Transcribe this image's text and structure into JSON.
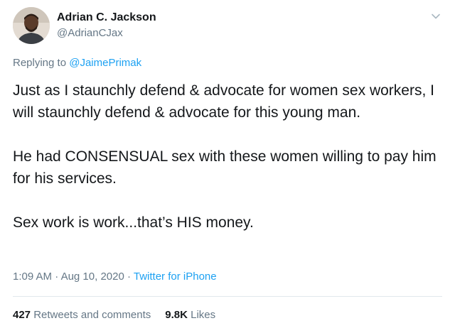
{
  "author": {
    "name": "Adrian C. Jackson",
    "handle": "@AdrianCJax"
  },
  "reply": {
    "prefix": "Replying to ",
    "to_handle": "@JaimePrimak"
  },
  "tweet": {
    "paragraphs": [
      "Just as I staunchly defend & advocate for women sex workers, I will staunchly defend & advocate for this young man.",
      "He had CONSENSUAL sex with these women willing to pay him for his services.",
      "Sex work is work...that’s HIS money."
    ]
  },
  "meta": {
    "time": "1:09 AM",
    "separator": " · ",
    "date": "Aug 10, 2020",
    "source": "Twitter for iPhone"
  },
  "stats": {
    "retweets_count": "427",
    "retweets_label": " Retweets and comments",
    "likes_count": "9.8K",
    "likes_label": " Likes"
  },
  "icons": {
    "menu": "chevron-down-icon",
    "avatar": "avatar"
  },
  "colors": {
    "link": "#1da1f2",
    "secondary_text": "#657786",
    "primary_text": "#14171a",
    "divider": "#e1e8ed"
  }
}
